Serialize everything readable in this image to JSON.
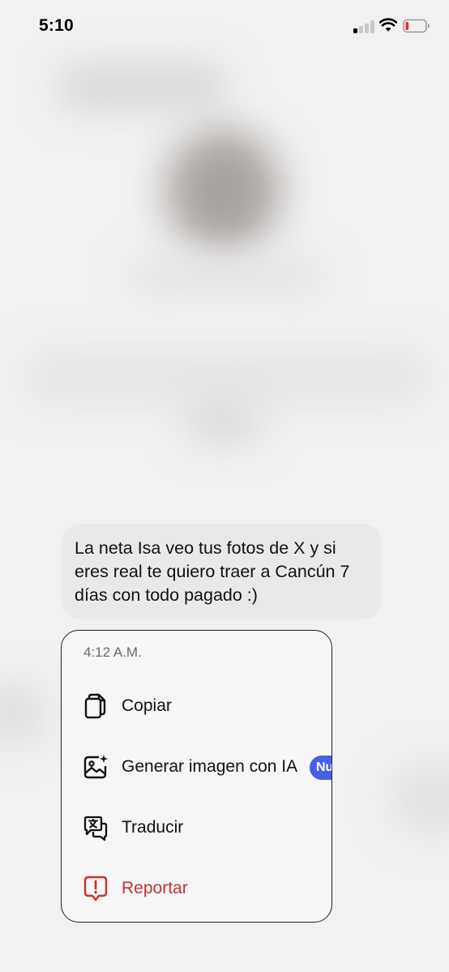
{
  "status_bar": {
    "time": "5:10",
    "signal_icon": "cellular-signal-icon",
    "wifi_icon": "wifi-icon",
    "battery_icon": "battery-low-icon",
    "battery_color": "#e0322e"
  },
  "message": {
    "text": "La neta Isa veo tus fotos de X y si eres real te quiero traer a Cancún 7 días con todo pagado :)"
  },
  "context_menu": {
    "timestamp": "4:12 A.M.",
    "items": [
      {
        "label": "Copiar",
        "icon": "copy-icon"
      },
      {
        "label": "Generar imagen con IA",
        "icon": "ai-image-icon",
        "badge": "Nu"
      },
      {
        "label": "Traducir",
        "icon": "translate-icon"
      },
      {
        "label": "Reportar",
        "icon": "report-icon",
        "color": "#c9302c"
      }
    ]
  },
  "colors": {
    "background": "#f1f1f2",
    "bubble": "#e9e9eb",
    "badge": "#4b5ee6",
    "danger": "#c9302c"
  }
}
